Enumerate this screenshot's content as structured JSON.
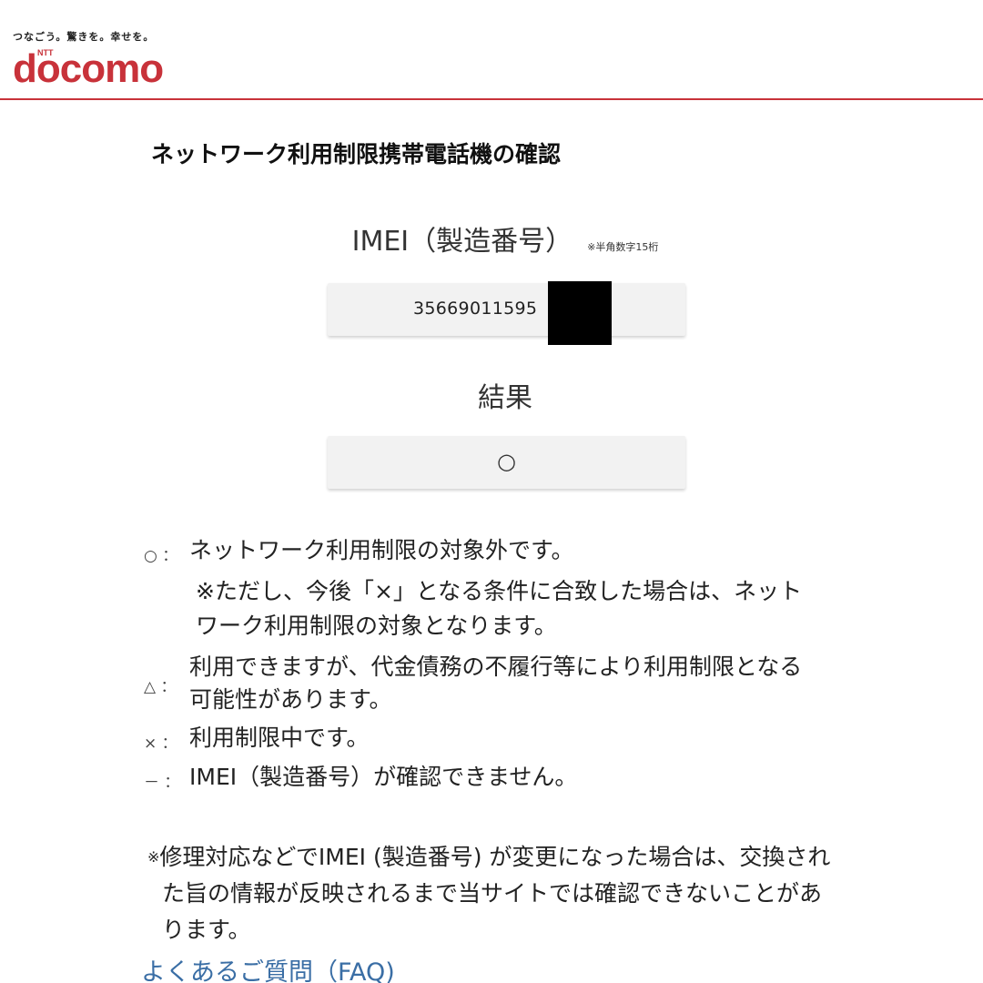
{
  "brand": {
    "tagline": "つなごう。驚きを。幸せを。",
    "logo_small": "NTT",
    "logo_word": "docomo",
    "accent_color": "#c8323a"
  },
  "page_title": "ネットワーク利用制限携帯電話機の確認",
  "imei": {
    "label": "IMEI（製造番号）",
    "note": "※半角数字15桁",
    "value": "35669011595"
  },
  "result": {
    "label": "結果",
    "value": "○"
  },
  "legend": [
    {
      "symbol": "○ ：",
      "text": "ネットワーク利用制限の対象外です。"
    },
    {
      "symbol": "△ ：",
      "text": "利用できますが、代金債務の不履行等により利用制限となる"
    },
    {
      "symbol": "× ：",
      "text": "利用制限中です。"
    },
    {
      "symbol": "－ ：",
      "text": "IMEI（製造番号）が確認できません。"
    }
  ],
  "legend_sub": {
    "circle_line1": "※ただし、今後「×」となる条件に合致した場合は、ネット",
    "circle_line2": "ワーク利用制限の対象となります。",
    "triangle_line2": "可能性があります。"
  },
  "footnote": {
    "mark": "※",
    "line1": "修理対応などでIMEI (製造番号) が変更になった場合は、交換され",
    "line2": "た旨の情報が反映されるまで当サイトでは確認できないことがあ",
    "line3": "ります。"
  },
  "faq_link": "よくあるご質問（FAQ)",
  "link_color": "#3a6ea5"
}
